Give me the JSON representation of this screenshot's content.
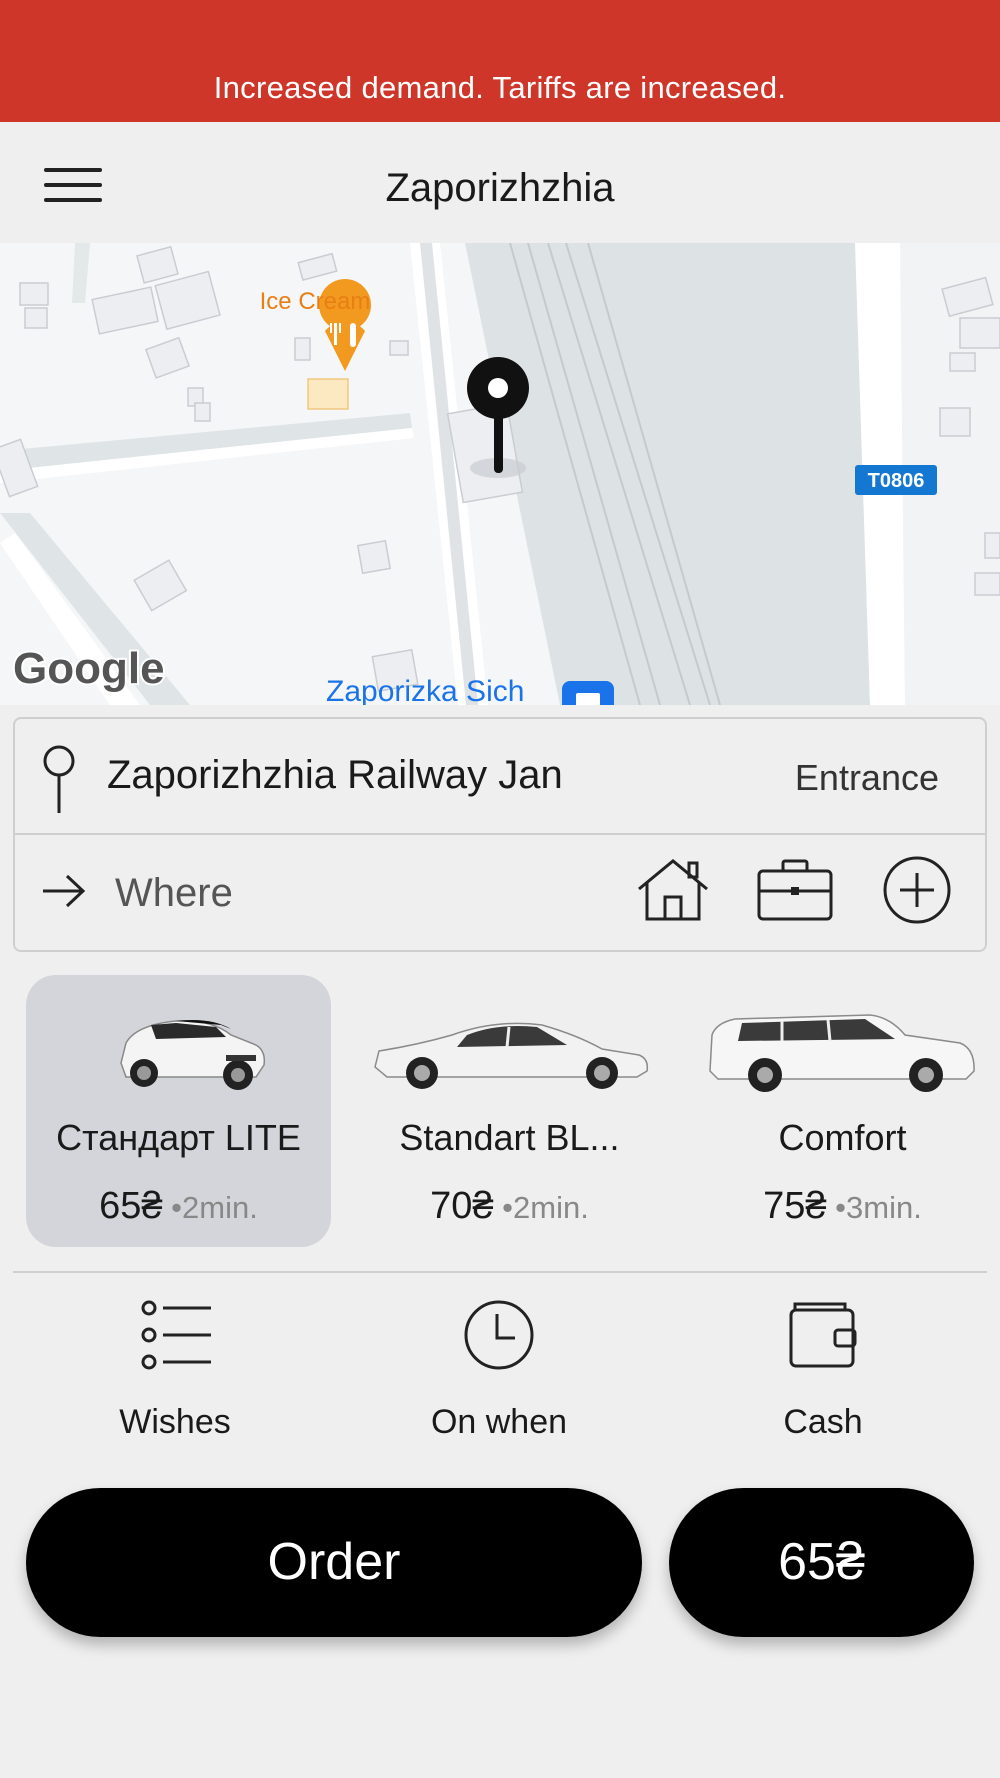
{
  "banner": {
    "text": "Increased demand. Tariffs are increased.",
    "color": "#cf362a"
  },
  "header": {
    "city": "Zaporizhzhia",
    "menu_icon": "hamburger-menu-icon"
  },
  "map": {
    "poi_label": "Ice Cream",
    "station_label": "Zaporizka Sich",
    "road_badge": "T0806",
    "attribution": "Google"
  },
  "route": {
    "from": {
      "text": "Zaporizhzhia Railway Jan",
      "entrance_label": "Entrance",
      "icon": "location-pin-icon"
    },
    "to": {
      "placeholder": "Where",
      "icon": "arrow-right-icon"
    },
    "quick_icons": [
      "home-icon",
      "briefcase-icon",
      "plus-circle-icon"
    ]
  },
  "tariffs": [
    {
      "name": "Стандарт LITE",
      "amount": "65₴",
      "eta": " •2min.",
      "selected": true
    },
    {
      "name": "Standart BL...",
      "amount": "70₴",
      "eta": " •2min.",
      "selected": false
    },
    {
      "name": "Comfort",
      "amount": "75₴",
      "eta": " •3min.",
      "selected": false
    }
  ],
  "options": [
    {
      "label": "Wishes",
      "icon": "list-icon"
    },
    {
      "label": "On when",
      "icon": "clock-icon"
    },
    {
      "label": "Cash",
      "icon": "wallet-icon"
    }
  ],
  "actions": {
    "order_label": "Order",
    "price_label": "65₴"
  },
  "colors": {
    "accent": "#000000",
    "selected_tariff_bg": "#d3d5da",
    "poi": "#f29a1f",
    "transit": "#1a73e8"
  }
}
